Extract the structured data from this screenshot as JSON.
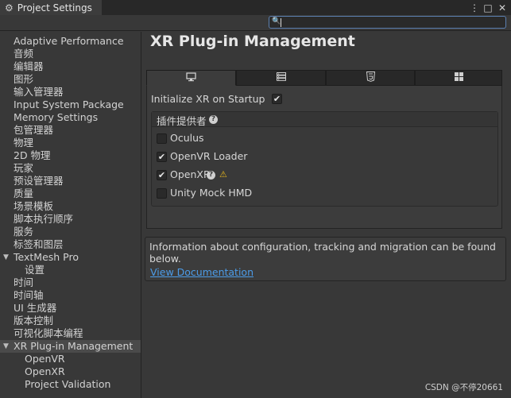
{
  "window": {
    "tab_title": "Project Settings",
    "tab_icon": "gear-icon",
    "controls": {
      "menu": "⋮",
      "maximize": "□",
      "close": "✕"
    }
  },
  "search": {
    "value": "",
    "placeholder": ""
  },
  "sidebar": {
    "items": [
      {
        "label": "Adaptive Performance",
        "indent": 0
      },
      {
        "label": "音频",
        "indent": 0
      },
      {
        "label": "编辑器",
        "indent": 0
      },
      {
        "label": "图形",
        "indent": 0
      },
      {
        "label": "输入管理器",
        "indent": 0
      },
      {
        "label": "Input System Package",
        "indent": 0
      },
      {
        "label": "Memory Settings",
        "indent": 0
      },
      {
        "label": "包管理器",
        "indent": 0
      },
      {
        "label": "物理",
        "indent": 0
      },
      {
        "label": "2D 物理",
        "indent": 0
      },
      {
        "label": "玩家",
        "indent": 0
      },
      {
        "label": "预设管理器",
        "indent": 0
      },
      {
        "label": "质量",
        "indent": 0
      },
      {
        "label": "场景模板",
        "indent": 0
      },
      {
        "label": "脚本执行顺序",
        "indent": 0
      },
      {
        "label": "服务",
        "indent": 0
      },
      {
        "label": "标签和图层",
        "indent": 0
      },
      {
        "label": "TextMesh Pro",
        "indent": 0,
        "expanded": true
      },
      {
        "label": "设置",
        "indent": 1
      },
      {
        "label": "时间",
        "indent": 0
      },
      {
        "label": "时间轴",
        "indent": 0
      },
      {
        "label": "UI 生成器",
        "indent": 0
      },
      {
        "label": "版本控制",
        "indent": 0
      },
      {
        "label": "可视化脚本编程",
        "indent": 0
      },
      {
        "label": "XR Plug-in Management",
        "indent": 0,
        "expanded": true,
        "selected": true
      },
      {
        "label": "OpenVR",
        "indent": 1
      },
      {
        "label": "OpenXR",
        "indent": 1
      },
      {
        "label": "Project Validation",
        "indent": 1
      }
    ]
  },
  "main": {
    "title": "XR Plug-in Management",
    "platform_tabs": [
      {
        "icon": "desktop-icon",
        "active": true
      },
      {
        "icon": "server-icon",
        "active": false
      },
      {
        "icon": "html5-icon",
        "active": false
      },
      {
        "icon": "windows-icon",
        "active": false
      }
    ],
    "init_label": "Initialize XR on Startup",
    "init_checked": true,
    "providers_title": "插件提供者",
    "providers": [
      {
        "label": "Oculus",
        "checked": false
      },
      {
        "label": "OpenVR Loader",
        "checked": true
      },
      {
        "label": "OpenXR",
        "checked": true
      },
      {
        "label": "Unity Mock HMD",
        "checked": false
      }
    ],
    "info_text": "Information about configuration, tracking and migration can be found below.",
    "link_text": "View Documentation"
  },
  "watermark": "CSDN @不停20661",
  "colors": {
    "link": "#4c9ce8",
    "warning": "#e4b41c",
    "background": "#383838"
  }
}
